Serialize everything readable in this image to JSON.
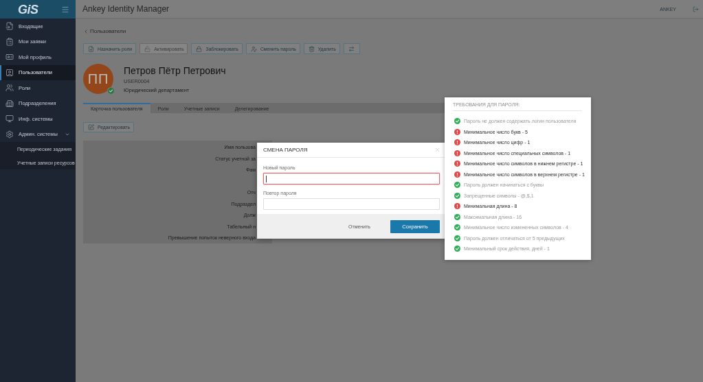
{
  "sidebar": {
    "logo": "GiS",
    "items": [
      {
        "label": "Входящие",
        "selected": false
      },
      {
        "label": "Мои заявки",
        "selected": false
      },
      {
        "label": "Мой профиль",
        "selected": false
      },
      {
        "label": "Пользователи",
        "selected": true
      },
      {
        "label": "Роли",
        "selected": false
      },
      {
        "label": "Подразделения",
        "selected": false
      },
      {
        "label": "Инф. системы",
        "selected": false
      },
      {
        "label": "Админ. системы",
        "selected": false,
        "expanded": true,
        "children": [
          {
            "label": "Периодические задания",
            "selected": false
          },
          {
            "label": "Учетные записи ресурсов",
            "selected": false
          }
        ]
      }
    ]
  },
  "header": {
    "title": "Ankey Identity Manager",
    "user": "ANKEY"
  },
  "breadcrumb": "Пользователи",
  "toolbar": [
    {
      "label": "Назначить роли",
      "disabled": false
    },
    {
      "label": "Активировать",
      "disabled": true
    },
    {
      "label": "Заблокировать",
      "disabled": false
    },
    {
      "label": "Сменить пароль",
      "disabled": false
    },
    {
      "label": "Удалить",
      "disabled": false
    }
  ],
  "profile": {
    "initials": "ПП",
    "active": true,
    "name": "Петров Пётр Петрович",
    "login": "USER0004",
    "department": "Юридический департамент"
  },
  "tabs": [
    {
      "label": "Карточка пользователя",
      "selected": true
    },
    {
      "label": "Роли",
      "selected": false
    },
    {
      "label": "Учетные записи",
      "selected": false
    },
    {
      "label": "Делегирование",
      "selected": false
    }
  ],
  "edit_button": "Редактировать",
  "form": {
    "labels": [
      "Имя пользова",
      "Статус учетной за",
      "Фам",
      "Отч",
      "Подраздел",
      "Долж",
      "Табельный н",
      "Превышение попыток неверного входа"
    ]
  },
  "dialog": {
    "title": "СМЕНА ПАРОЛЯ",
    "fields": [
      {
        "label": "Новый пароль",
        "invalid": true,
        "focused": true
      },
      {
        "label": "Повтор пароля",
        "invalid": false,
        "focused": false
      }
    ],
    "buttons": [
      {
        "label": "Отменить",
        "kind": "secondary"
      },
      {
        "label": "Сохранить",
        "kind": "primary"
      }
    ]
  },
  "password_requirements": {
    "title": "ТРЕБОВАНИЯ ДЛЯ ПАРОЛЯ:",
    "items": [
      {
        "text": "Пароль не должен содержать логин пользователя",
        "met": true
      },
      {
        "text": "Минимальное число букв - 5",
        "met": false
      },
      {
        "text": "Минимальное число цифр - 1",
        "met": false
      },
      {
        "text": "Минимальное число специальных символов - 1",
        "met": false
      },
      {
        "text": "Минимальное число символов в нижнем регистре - 1",
        "met": false
      },
      {
        "text": "Минимальное число символов в верхнем регистре - 1",
        "met": false
      },
      {
        "text": "Пароль должен начинаться с буквы",
        "met": true
      },
      {
        "text": "Запрещенные символы - @,$,1",
        "met": true
      },
      {
        "text": "Минимальная длина - 8",
        "met": false
      },
      {
        "text": "Максимальная длина - 16",
        "met": true
      },
      {
        "text": "Минимальное число измененных символов - 4",
        "met": true
      },
      {
        "text": "Пароль должен отличаться от 5 предыдущих",
        "met": true
      },
      {
        "text": "Минимальный срок действия, дней - 1",
        "met": true
      }
    ]
  }
}
